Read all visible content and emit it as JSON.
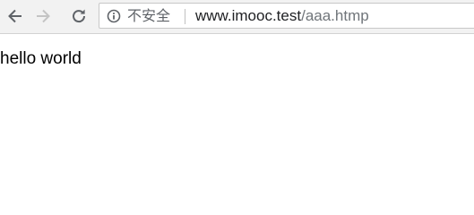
{
  "toolbar": {
    "back_icon": "back-arrow-icon",
    "forward_icon": "forward-arrow-icon",
    "reload_icon": "reload-icon",
    "colors": {
      "toolbar_bg": "#f2f2f2",
      "enabled_icon": "#5f6368",
      "disabled_icon": "#c4c4c4"
    }
  },
  "omnibox": {
    "security_icon": "info-circle-icon",
    "security_label": "不安全",
    "url_host": "www.imooc.test",
    "url_path": "/aaa.htmp"
  },
  "page": {
    "body_text": "hello world"
  }
}
